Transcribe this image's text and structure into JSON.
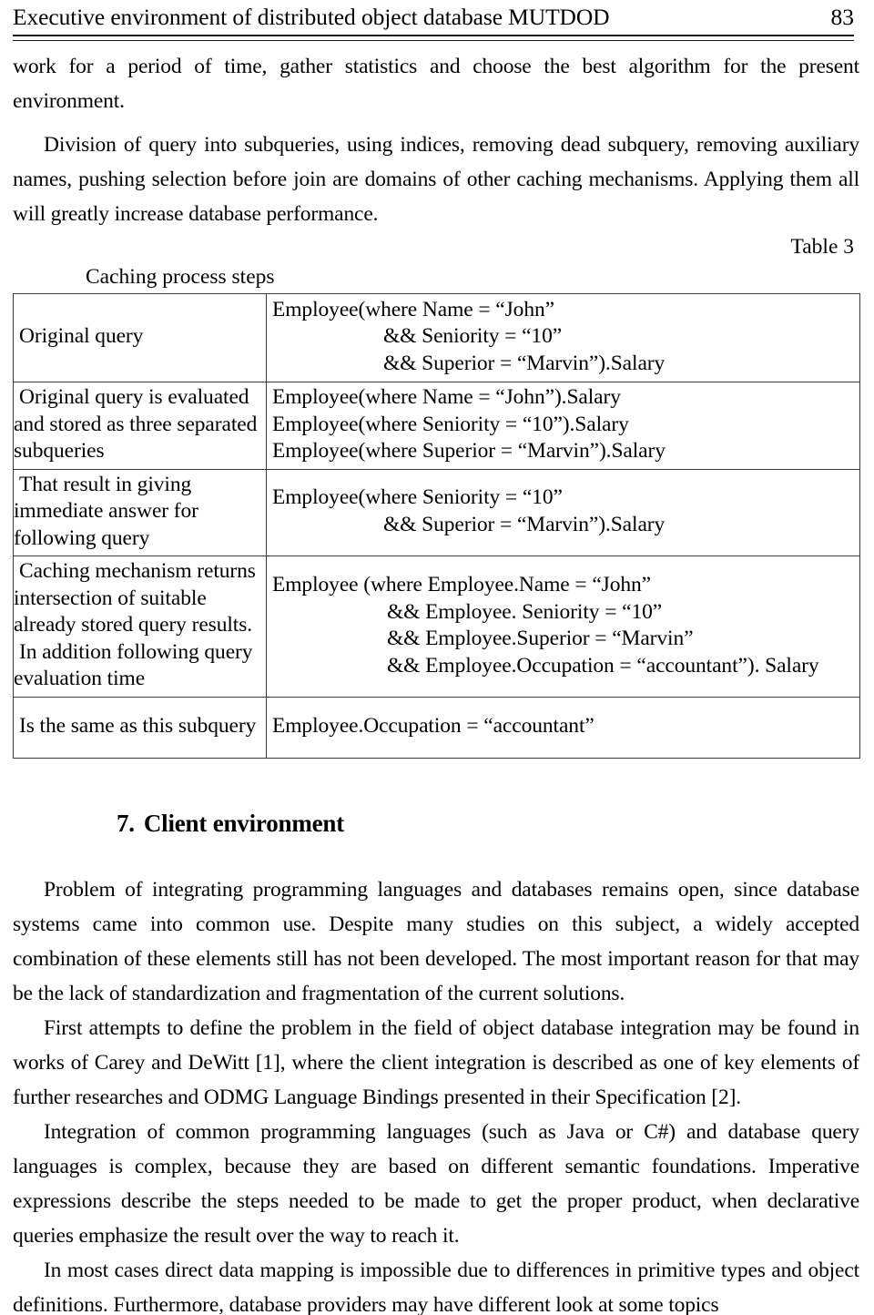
{
  "header": {
    "title": "Executive environment of distributed object database MUTDOD",
    "page_number": "83"
  },
  "body": {
    "para_continued": "work for a period of time, gather statistics and choose the best algorithm for the present environment.",
    "para_division": "Division of query into subqueries, using indices, removing dead subquery, removing auxiliary names, pushing selection before join are domains of other caching mechanisms. Applying them all will greatly increase database performance."
  },
  "table": {
    "label": "Table 3",
    "column_header": "Caching process steps",
    "rows": [
      {
        "description": "Original query",
        "query_lines": [
          "Employee(where  Name = “John”",
          "&& Seniority = “10”",
          "&& Superior = “Marvin”).Salary"
        ]
      },
      {
        "description": "Original query is evaluated and stored as three separated subqueries",
        "description_last": "separated subqueries",
        "query_lines": [
          "Employee(where Name = “John”).Salary",
          "Employee(where Seniority = “10”).Salary",
          "Employee(where Superior = “Marvin”).Salary"
        ]
      },
      {
        "description": "That result in giving immediate answer for following query",
        "description_last": "lowing query",
        "query_lines": [
          "Employee(where Seniority = “10”",
          "&& Superior = “Marvin”).Salary"
        ]
      },
      {
        "description": "Caching mechanism returns intersection of suitable already stored query results.",
        "description_last": "results.",
        "description_extra": "In addition following query evaluation time",
        "description_extra_last": "query evaluation time",
        "query_lines": [
          "Employee (where Employee.Name = “John”",
          "&& Employee. Seniority = “10”",
          "&& Employee.Superior = “Marvin”",
          "&& Employee.Occupation = “accountant”). Salary"
        ]
      },
      {
        "description": "Is the same as this subquery",
        "description_last": "query",
        "query_lines": [
          "Employee.Occupation = “accountant”"
        ]
      }
    ]
  },
  "section": {
    "number": "7.",
    "title": "Client environment"
  },
  "paragraphs": [
    "Problem of integrating programming languages and databases remains open, since database systems came into common use. Despite many studies on this subject, a widely accepted combination of these elements still has not been developed. The most important reason for that may be the lack of standardization and fragmentation of the current solutions.",
    "First attempts to define the problem in the field of object database integration may be found in works of Carey and DeWitt [1], where the client integration is described as one of key elements of further researches and ODMG Language Bindings presented in their Specification [2].",
    "Integration of common programming languages (such as Java or C#) and database query languages is complex, because they are based on different semantic foundations.  Imperative expressions describe the steps needed to be made to get the proper product, when declarative queries emphasize the result over the way to reach it.",
    "In most cases direct data mapping is impossible due to differences in primitive types and object definitions. Furthermore, database providers may have different look at some topics"
  ]
}
